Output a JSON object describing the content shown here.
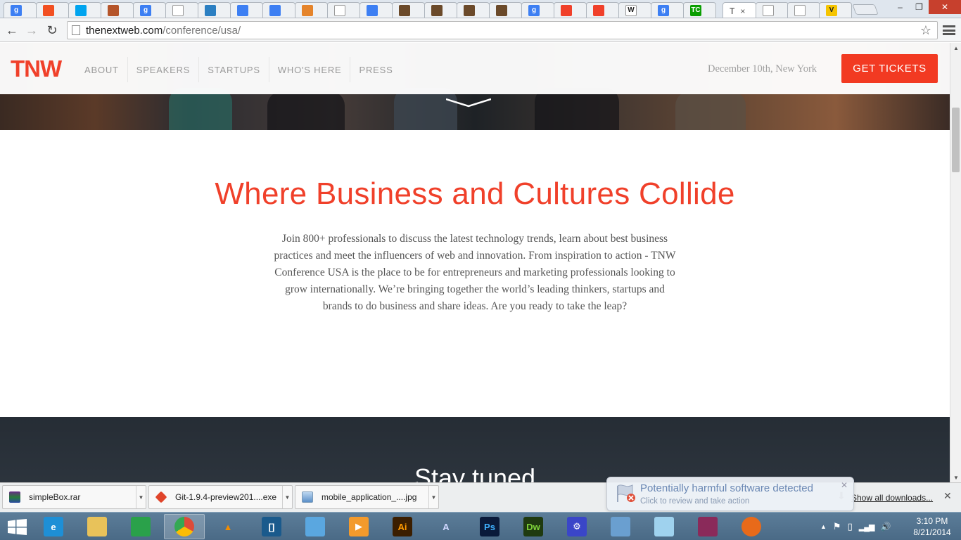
{
  "browser": {
    "active_tab": {
      "title": "T",
      "close": "×"
    },
    "tabs": [
      {
        "icon": "google-icon",
        "glyph": "g",
        "color": "#3d7ff3"
      },
      {
        "icon": "windows-store-icon",
        "glyph": "",
        "color": "#f25022"
      },
      {
        "icon": "microsoft-icon",
        "glyph": "",
        "color": "#00a4ef"
      },
      {
        "icon": "firefox-addon-icon",
        "glyph": "",
        "color": "#b5552a"
      },
      {
        "icon": "google-icon",
        "glyph": "g",
        "color": "#3d7ff3"
      },
      {
        "icon": "page-icon",
        "glyph": "",
        "color": "#ffffff"
      },
      {
        "icon": "dell-icon",
        "glyph": "",
        "color": "#2b7fc2"
      },
      {
        "icon": "chrome-webstore-icon",
        "glyph": "",
        "color": "#3d7ff3"
      },
      {
        "icon": "chrome-webstore-icon",
        "glyph": "",
        "color": "#3d7ff3"
      },
      {
        "icon": "tools-icon",
        "glyph": "",
        "color": "#e5842b"
      },
      {
        "icon": "page-icon",
        "glyph": "",
        "color": "#ffffff"
      },
      {
        "icon": "chrome-webstore-icon",
        "glyph": "",
        "color": "#3d7ff3"
      },
      {
        "icon": "book-icon",
        "glyph": "",
        "color": "#6b4a2a"
      },
      {
        "icon": "book-icon",
        "glyph": "",
        "color": "#6b4a2a"
      },
      {
        "icon": "book-icon",
        "glyph": "",
        "color": "#6b4a2a"
      },
      {
        "icon": "book-icon",
        "glyph": "",
        "color": "#6b4a2a"
      },
      {
        "icon": "google-icon",
        "glyph": "g",
        "color": "#3d7ff3"
      },
      {
        "icon": "tnw-icon",
        "glyph": "",
        "color": "#f0402a"
      },
      {
        "icon": "tnw-icon",
        "glyph": "",
        "color": "#f0402a"
      },
      {
        "icon": "wikipedia-icon",
        "glyph": "W",
        "color": "#ffffff"
      },
      {
        "icon": "google-icon",
        "glyph": "g",
        "color": "#3d7ff3"
      },
      {
        "icon": "techcrunch-icon",
        "glyph": "TC",
        "color": "#0a9e01"
      }
    ],
    "tabs_after": [
      {
        "icon": "page-icon",
        "glyph": "",
        "color": "#ffffff"
      },
      {
        "icon": "page-icon",
        "glyph": "",
        "color": "#ffffff"
      },
      {
        "icon": "v-icon",
        "glyph": "V",
        "color": "#f5c400"
      }
    ],
    "window_buttons": {
      "minimize": "–",
      "maximize": "❐",
      "close": "✕"
    },
    "url_host": "thenextweb.com",
    "url_path": "/conference/usa/",
    "nav": {
      "back": "←",
      "forward": "→",
      "reload": "↻",
      "star": "☆"
    }
  },
  "site": {
    "logo": "TNW",
    "nav_links": [
      "ABOUT",
      "SPEAKERS",
      "STARTUPS",
      "WHO'S HERE",
      "PRESS"
    ],
    "event_date": "December 10th, New York",
    "cta": "GET TICKETS",
    "headline": "Where Business and Cultures Collide",
    "intro_text": "Join 800+ professionals to discuss the latest technology trends, learn about best business practices and meet the influencers of web and innovation. From inspiration to action - TNW Conference USA is the place to be for entrepreneurs and marketing professionals looking to grow internationally. We’re bringing together the world’s leading thinkers, startups and brands to do business and share ideas. Are you ready to take the leap?",
    "section2_title": "Stay tuned"
  },
  "downloads": {
    "items": [
      "simpleBox.rar",
      "Git-1.9.4-preview201....exe",
      "mobile_application_....jpg"
    ],
    "show_all": "Show all downloads...",
    "close": "✕"
  },
  "notification": {
    "title": "Potentially harmful software detected",
    "subtitle": "Click to review and take action",
    "close": "✕"
  },
  "taskbar": {
    "apps": [
      {
        "name": "internet-explorer-icon",
        "label": "e",
        "bg": "#1e8fd6",
        "fg": "#ffffff"
      },
      {
        "name": "file-explorer-icon",
        "label": "",
        "bg": "#e8c25a",
        "fg": "#ffffff"
      },
      {
        "name": "store-icon",
        "label": "",
        "bg": "#2aa14a",
        "fg": "#ffffff"
      },
      {
        "name": "chrome-icon",
        "label": "",
        "bg": "#dd4b39",
        "fg": "#ffffff"
      },
      {
        "name": "vlc-icon",
        "label": "▲",
        "bg": "transparent",
        "fg": "#f28c00"
      },
      {
        "name": "brackets-icon",
        "label": "[]",
        "bg": "#1a5a8c",
        "fg": "#ffffff"
      },
      {
        "name": "photo-viewer-icon",
        "label": "",
        "bg": "#5aa7e0",
        "fg": "#ffffff"
      },
      {
        "name": "media-player-icon",
        "label": "▶",
        "bg": "#f39a2c",
        "fg": "#ffffff"
      },
      {
        "name": "illustrator-icon",
        "label": "Ai",
        "bg": "#3b1e00",
        "fg": "#ff9a00"
      },
      {
        "name": "inkscape-icon",
        "label": "A",
        "bg": "transparent",
        "fg": "#d0d8ff"
      },
      {
        "name": "photoshop-icon",
        "label": "Ps",
        "bg": "#0a1a3a",
        "fg": "#3fb1ff"
      },
      {
        "name": "dreamweaver-icon",
        "label": "Dw",
        "bg": "#1f3a10",
        "fg": "#7fd43a"
      },
      {
        "name": "settings-icon",
        "label": "⚙",
        "bg": "#3a46c8",
        "fg": "#ffffff"
      },
      {
        "name": "control-panel-icon",
        "label": "",
        "bg": "#6a9fd0",
        "fg": "#ffffff"
      },
      {
        "name": "notes-icon",
        "label": "",
        "bg": "#9fd2ee",
        "fg": "#ffffff"
      },
      {
        "name": "winrar-icon",
        "label": "",
        "bg": "#8a2a5a",
        "fg": "#ffffff"
      },
      {
        "name": "firefox-icon",
        "label": "",
        "bg": "#e86a1a",
        "fg": "#ffffff"
      }
    ],
    "tray": {
      "chevron": "▲",
      "volume": "🔊"
    },
    "time": "3:10 PM",
    "date": "8/21/2014"
  },
  "colors": {
    "accent": "#f0402a",
    "cta": "#f23a22"
  }
}
